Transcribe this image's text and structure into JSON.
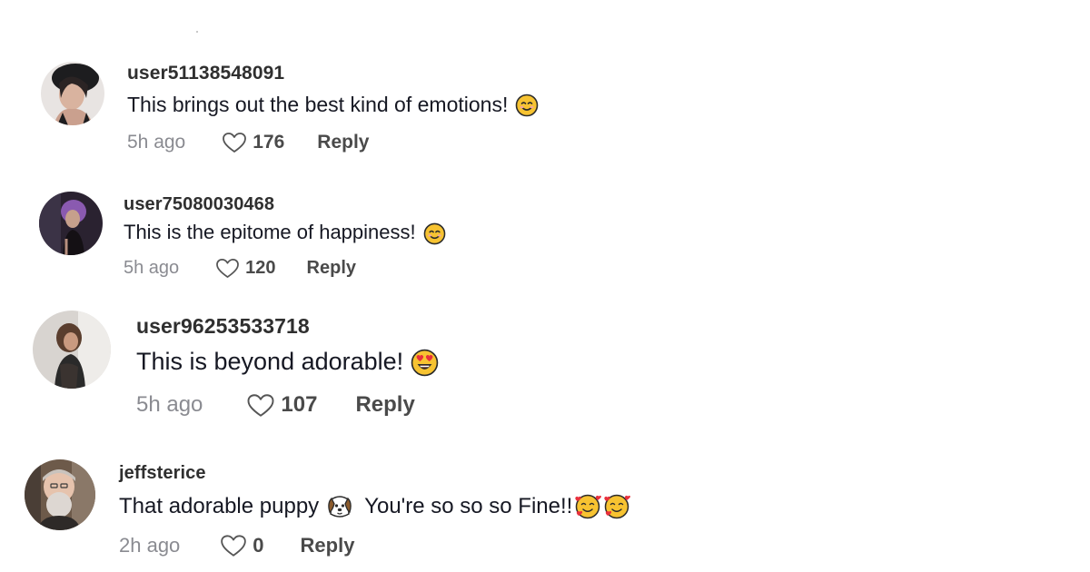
{
  "comments": [
    {
      "username": "user51138548091",
      "text": "This brings out the best kind of emotions!",
      "emojis": [
        "smiling-face-emoji"
      ],
      "time": "5h ago",
      "likes": "176",
      "reply_label": "Reply"
    },
    {
      "username": "user75080030468",
      "text": "This is the epitome of happiness!",
      "emojis": [
        "smiling-face-emoji"
      ],
      "time": "5h ago",
      "likes": "120",
      "reply_label": "Reply"
    },
    {
      "username": "user96253533718",
      "text": "This is beyond adorable!",
      "emojis": [
        "heart-eyes-emoji"
      ],
      "time": "5h ago",
      "likes": "107",
      "reply_label": "Reply"
    },
    {
      "username": "jeffsterice",
      "text_before": "That adorable puppy",
      "text_after": "You're so so so Fine!!",
      "emojis": [
        "puppy-face-emoji",
        "smiling-hearts-emoji",
        "smiling-hearts-emoji"
      ],
      "time": "2h ago",
      "likes": "0",
      "reply_label": "Reply"
    }
  ],
  "colors": {
    "text": "#161823",
    "username": "#2f2f2f",
    "muted": "#8a8b91",
    "action": "#4a4a4a",
    "emoji_yellow": "#f7c331"
  }
}
